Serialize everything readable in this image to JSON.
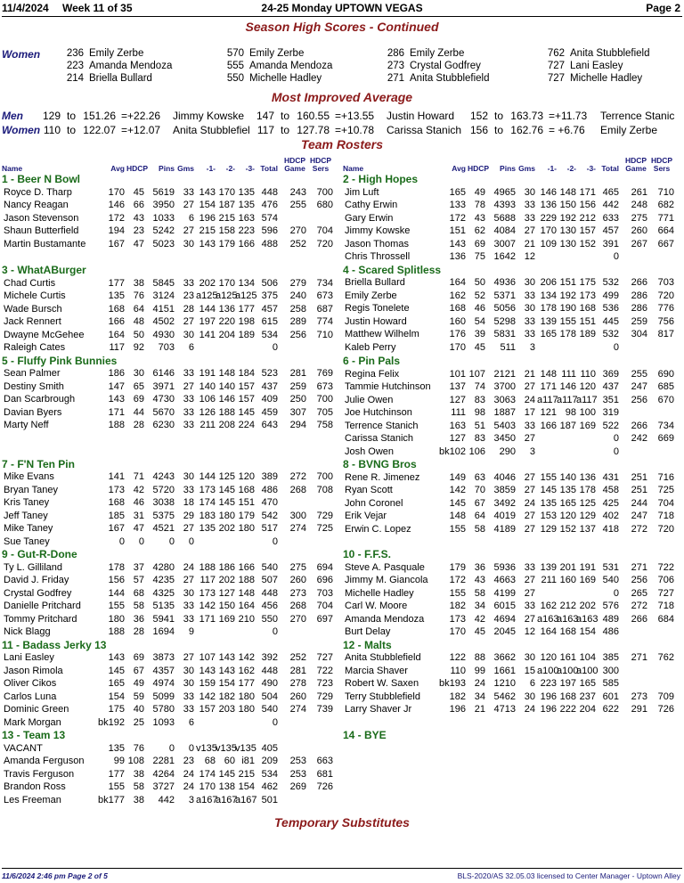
{
  "header": {
    "date": "11/4/2024",
    "week": "Week 11 of 35",
    "title": "24-25 Monday UPTOWN VEGAS",
    "page": "Page 2"
  },
  "sections": {
    "season_high": "Season High Scores - Continued",
    "most_improved": "Most Improved Average",
    "rosters": "Team Rosters",
    "temp_subs": "Temporary Substitutes"
  },
  "season_high": {
    "label": "Women",
    "blocks": [
      [
        [
          "236",
          "Emily Zerbe"
        ],
        [
          "223",
          "Amanda Mendoza"
        ],
        [
          "214",
          "Briella Bullard"
        ]
      ],
      [
        [
          "570",
          "Emily Zerbe"
        ],
        [
          "555",
          "Amanda Mendoza"
        ],
        [
          "550",
          "Michelle Hadley"
        ]
      ],
      [
        [
          "286",
          "Emily Zerbe"
        ],
        [
          "273",
          "Crystal Godfrey"
        ],
        [
          "271",
          "Anita Stubblefield"
        ]
      ],
      [
        [
          "762",
          "Anita Stubblefield"
        ],
        [
          "727",
          "Lani Easley"
        ],
        [
          "727",
          "Michelle Hadley"
        ]
      ]
    ]
  },
  "most_improved": [
    {
      "label": "Men",
      "entries": [
        [
          "129",
          "to",
          "151.26",
          "=+22.26",
          "Jimmy Kowske"
        ],
        [
          "147",
          "to",
          "160.55",
          "=+13.55",
          "Justin Howard"
        ],
        [
          "152",
          "to",
          "163.73",
          "=+11.73",
          "Terrence Stanic"
        ]
      ]
    },
    {
      "label": "Women",
      "entries": [
        [
          "110",
          "to",
          "122.07",
          "=+12.07",
          "Anita Stubblefiel"
        ],
        [
          "117",
          "to",
          "127.78",
          "=+10.78",
          "Carissa Stanich"
        ],
        [
          "156",
          "to",
          "162.76",
          "= +6.76",
          "Emily Zerbe"
        ]
      ]
    }
  ],
  "col_headers": {
    "name": "Name",
    "avg": "Avg",
    "hdcp": "HDCP",
    "pins": "Pins",
    "gms": "Gms",
    "g1": "-1-",
    "g2": "-2-",
    "g3": "-3-",
    "total": "Total",
    "hdcp_game": "HDCP Game",
    "hdcp_sers": "HDCP Sers"
  },
  "left_teams": [
    {
      "name": "1 - Beer N Bowl",
      "players": [
        [
          "Royce D. Tharp",
          "170",
          "45",
          "5619",
          "33",
          "143",
          "170",
          "135",
          "448",
          "243",
          "700"
        ],
        [
          "Nancy Reagan",
          "146",
          "66",
          "3950",
          "27",
          "154",
          "187",
          "135",
          "476",
          "255",
          "680"
        ],
        [
          "Jason Stevenson",
          "172",
          "43",
          "1033",
          "6",
          "196",
          "215",
          "163",
          "574",
          "",
          ""
        ],
        [
          "Shaun Butterfield",
          "194",
          "23",
          "5242",
          "27",
          "215",
          "158",
          "223",
          "596",
          "270",
          "704"
        ],
        [
          "Martin Bustamante",
          "167",
          "47",
          "5023",
          "30",
          "143",
          "179",
          "166",
          "488",
          "252",
          "720"
        ]
      ]
    },
    {
      "name": "3 - WhatABurger",
      "players": [
        [
          "Chad Curtis",
          "177",
          "38",
          "5845",
          "33",
          "202",
          "170",
          "134",
          "506",
          "279",
          "734"
        ],
        [
          "Michele Curtis",
          "135",
          "76",
          "3124",
          "23",
          "a125",
          "a125",
          "a125",
          "375",
          "240",
          "673"
        ],
        [
          "Wade Bursch",
          "168",
          "64",
          "4151",
          "28",
          "144",
          "136",
          "177",
          "457",
          "258",
          "687"
        ],
        [
          "Jack Rennert",
          "166",
          "48",
          "4502",
          "27",
          "197",
          "220",
          "198",
          "615",
          "289",
          "774"
        ],
        [
          "Dwayne McGehee",
          "164",
          "50",
          "4930",
          "30",
          "141",
          "204",
          "189",
          "534",
          "256",
          "710"
        ],
        [
          "Raleigh Cates",
          "117",
          "92",
          "703",
          "6",
          "",
          "",
          "",
          "0",
          "",
          ""
        ]
      ]
    },
    {
      "name": "5 - Fluffy Pink Bunnies",
      "players": [
        [
          "Sean Palmer",
          "186",
          "30",
          "6146",
          "33",
          "191",
          "148",
          "184",
          "523",
          "281",
          "769"
        ],
        [
          "Destiny Smith",
          "147",
          "65",
          "3971",
          "27",
          "140",
          "140",
          "157",
          "437",
          "259",
          "673"
        ],
        [
          "Dan Scarbrough",
          "143",
          "69",
          "4730",
          "33",
          "106",
          "146",
          "157",
          "409",
          "250",
          "700"
        ],
        [
          "Davian Byers",
          "171",
          "44",
          "5670",
          "33",
          "126",
          "188",
          "145",
          "459",
          "307",
          "705"
        ],
        [
          "Marty Neff",
          "188",
          "28",
          "6230",
          "33",
          "211",
          "208",
          "224",
          "643",
          "294",
          "758"
        ]
      ]
    },
    {
      "name": "7 - F'N Ten Pin",
      "players": [
        [
          "Mike Evans",
          "141",
          "71",
          "4243",
          "30",
          "144",
          "125",
          "120",
          "389",
          "272",
          "700"
        ],
        [
          "Bryan Taney",
          "173",
          "42",
          "5720",
          "33",
          "173",
          "145",
          "168",
          "486",
          "268",
          "708"
        ],
        [
          "Kris Taney",
          "168",
          "46",
          "3038",
          "18",
          "174",
          "145",
          "151",
          "470",
          "",
          ""
        ],
        [
          "Jeff Taney",
          "185",
          "31",
          "5375",
          "29",
          "183",
          "180",
          "179",
          "542",
          "300",
          "729"
        ],
        [
          "Mike Taney",
          "167",
          "47",
          "4521",
          "27",
          "135",
          "202",
          "180",
          "517",
          "274",
          "725"
        ],
        [
          "Sue Taney",
          "0",
          "0",
          "0",
          "0",
          "",
          "",
          "",
          "0",
          "",
          ""
        ]
      ]
    },
    {
      "name": "9 - Gut-R-Done",
      "players": [
        [
          "Ty L. Gilliland",
          "178",
          "37",
          "4280",
          "24",
          "188",
          "186",
          "166",
          "540",
          "275",
          "694"
        ],
        [
          "David J. Friday",
          "156",
          "57",
          "4235",
          "27",
          "117",
          "202",
          "188",
          "507",
          "260",
          "696"
        ],
        [
          "Crystal Godfrey",
          "144",
          "68",
          "4325",
          "30",
          "173",
          "127",
          "148",
          "448",
          "273",
          "703"
        ],
        [
          "Danielle Pritchard",
          "155",
          "58",
          "5135",
          "33",
          "142",
          "150",
          "164",
          "456",
          "268",
          "704"
        ],
        [
          "Tommy Pritchard",
          "180",
          "36",
          "5941",
          "33",
          "171",
          "169",
          "210",
          "550",
          "270",
          "697"
        ],
        [
          "Nick Blagg",
          "188",
          "28",
          "1694",
          "9",
          "",
          "",
          "",
          "0",
          "",
          ""
        ]
      ]
    },
    {
      "name": "11 - Badass Jerky 13",
      "players": [
        [
          "Lani Easley",
          "143",
          "69",
          "3873",
          "27",
          "107",
          "143",
          "142",
          "392",
          "252",
          "727"
        ],
        [
          "Jason Rimola",
          "145",
          "67",
          "4357",
          "30",
          "143",
          "143",
          "162",
          "448",
          "281",
          "722"
        ],
        [
          "Oliver Cikos",
          "165",
          "49",
          "4974",
          "30",
          "159",
          "154",
          "177",
          "490",
          "278",
          "723"
        ],
        [
          "Carlos Luna",
          "154",
          "59",
          "5099",
          "33",
          "142",
          "182",
          "180",
          "504",
          "260",
          "729"
        ],
        [
          "Dominic Green",
          "175",
          "40",
          "5780",
          "33",
          "157",
          "203",
          "180",
          "540",
          "274",
          "739"
        ],
        [
          "Mark Morgan",
          "bk192",
          "25",
          "1093",
          "6",
          "",
          "",
          "",
          "0",
          "",
          ""
        ]
      ]
    },
    {
      "name": "13 - Team 13",
      "players": [
        [
          "VACANT",
          "135",
          "76",
          "0",
          "0",
          "v135",
          "v135",
          "v135",
          "405",
          "",
          ""
        ],
        [
          "Amanda Ferguson",
          "99",
          "108",
          "2281",
          "23",
          "68",
          "60",
          "i81",
          "209",
          "253",
          "663"
        ],
        [
          "Travis Ferguson",
          "177",
          "38",
          "4264",
          "24",
          "174",
          "145",
          "215",
          "534",
          "253",
          "681"
        ],
        [
          "Brandon Ross",
          "155",
          "58",
          "3727",
          "24",
          "170",
          "138",
          "154",
          "462",
          "269",
          "726"
        ],
        [
          "Les Freeman",
          "bk177",
          "38",
          "442",
          "3",
          "a167",
          "a167",
          "a167",
          "501",
          "",
          ""
        ]
      ]
    }
  ],
  "right_teams": [
    {
      "name": "2 - High Hopes",
      "players": [
        [
          "Jim Luft",
          "165",
          "49",
          "4965",
          "30",
          "146",
          "148",
          "171",
          "465",
          "261",
          "710"
        ],
        [
          "Cathy Erwin",
          "133",
          "78",
          "4393",
          "33",
          "136",
          "150",
          "156",
          "442",
          "248",
          "682"
        ],
        [
          "Gary Erwin",
          "172",
          "43",
          "5688",
          "33",
          "229",
          "192",
          "212",
          "633",
          "275",
          "771"
        ],
        [
          "Jimmy Kowske",
          "151",
          "62",
          "4084",
          "27",
          "170",
          "130",
          "157",
          "457",
          "260",
          "664"
        ],
        [
          "Jason Thomas",
          "143",
          "69",
          "3007",
          "21",
          "109",
          "130",
          "152",
          "391",
          "267",
          "667"
        ],
        [
          "Chris Throssell",
          "136",
          "75",
          "1642",
          "12",
          "",
          "",
          "",
          "0",
          "",
          ""
        ]
      ]
    },
    {
      "name": "4 - Scared Splitless",
      "players": [
        [
          "Briella Bullard",
          "164",
          "50",
          "4936",
          "30",
          "206",
          "151",
          "175",
          "532",
          "266",
          "703"
        ],
        [
          "Emily Zerbe",
          "162",
          "52",
          "5371",
          "33",
          "134",
          "192",
          "173",
          "499",
          "286",
          "720"
        ],
        [
          "Regis Tonelete",
          "168",
          "46",
          "5056",
          "30",
          "178",
          "190",
          "168",
          "536",
          "286",
          "776"
        ],
        [
          "Justin Howard",
          "160",
          "54",
          "5298",
          "33",
          "139",
          "155",
          "151",
          "445",
          "259",
          "756"
        ],
        [
          "Matthew Wilhelm",
          "176",
          "39",
          "5831",
          "33",
          "165",
          "178",
          "189",
          "532",
          "304",
          "817"
        ],
        [
          "Kaleb Perry",
          "170",
          "45",
          "511",
          "3",
          "",
          "",
          "",
          "0",
          "",
          ""
        ]
      ]
    },
    {
      "name": "6 - Pin Pals",
      "players": [
        [
          "Regina Felix",
          "101",
          "107",
          "2121",
          "21",
          "148",
          "111",
          "110",
          "369",
          "255",
          "690"
        ],
        [
          "Tammie Hutchinson",
          "137",
          "74",
          "3700",
          "27",
          "171",
          "146",
          "120",
          "437",
          "247",
          "685"
        ],
        [
          "Julie Owen",
          "127",
          "83",
          "3063",
          "24",
          "a117",
          "a117",
          "a117",
          "351",
          "256",
          "670"
        ],
        [
          "Joe Hutchinson",
          "111",
          "98",
          "1887",
          "17",
          "121",
          "98",
          "100",
          "319",
          "",
          ""
        ],
        [
          "Terrence Stanich",
          "163",
          "51",
          "5403",
          "33",
          "166",
          "187",
          "169",
          "522",
          "266",
          "734"
        ],
        [
          "Carissa Stanich",
          "127",
          "83",
          "3450",
          "27",
          "",
          "",
          "",
          "0",
          "242",
          "669"
        ],
        [
          "Josh Owen",
          "bk102",
          "106",
          "290",
          "3",
          "",
          "",
          "",
          "0",
          "",
          ""
        ]
      ]
    },
    {
      "name": "8 - BVNG Bros",
      "players": [
        [
          "Rene R. Jimenez",
          "149",
          "63",
          "4046",
          "27",
          "155",
          "140",
          "136",
          "431",
          "251",
          "716"
        ],
        [
          "Ryan Scott",
          "142",
          "70",
          "3859",
          "27",
          "145",
          "135",
          "178",
          "458",
          "251",
          "725"
        ],
        [
          "John Coronel",
          "145",
          "67",
          "3492",
          "24",
          "135",
          "165",
          "125",
          "425",
          "244",
          "704"
        ],
        [
          "Erik Vejar",
          "148",
          "64",
          "4019",
          "27",
          "153",
          "120",
          "129",
          "402",
          "247",
          "718"
        ],
        [
          "Erwin C. Lopez",
          "155",
          "58",
          "4189",
          "27",
          "129",
          "152",
          "137",
          "418",
          "272",
          "720"
        ]
      ]
    },
    {
      "name": "10 - F.F.S.",
      "players": [
        [
          "Steve A. Pasquale",
          "179",
          "36",
          "5936",
          "33",
          "139",
          "201",
          "191",
          "531",
          "271",
          "722"
        ],
        [
          "Jimmy M. Giancola",
          "172",
          "43",
          "4663",
          "27",
          "211",
          "160",
          "169",
          "540",
          "256",
          "706"
        ],
        [
          "Michelle Hadley",
          "155",
          "58",
          "4199",
          "27",
          "",
          "",
          "",
          "0",
          "265",
          "727"
        ],
        [
          "Carl W. Moore",
          "182",
          "34",
          "6015",
          "33",
          "162",
          "212",
          "202",
          "576",
          "272",
          "718"
        ],
        [
          "Amanda Mendoza",
          "173",
          "42",
          "4694",
          "27",
          "a163",
          "a163",
          "a163",
          "489",
          "266",
          "684"
        ],
        [
          "Burt Delay",
          "170",
          "45",
          "2045",
          "12",
          "164",
          "168",
          "154",
          "486",
          "",
          ""
        ]
      ]
    },
    {
      "name": "12 - Malts",
      "players": [
        [
          "Anita Stubblefield",
          "122",
          "88",
          "3662",
          "30",
          "120",
          "161",
          "104",
          "385",
          "271",
          "762"
        ],
        [
          "Marcia Shaver",
          "110",
          "99",
          "1661",
          "15",
          "a100",
          "a100",
          "a100",
          "300",
          "",
          ""
        ],
        [
          "Robert W. Saxen",
          "bk193",
          "24",
          "1210",
          "6",
          "223",
          "197",
          "165",
          "585",
          "",
          ""
        ],
        [
          "Terry Stubblefield",
          "182",
          "34",
          "5462",
          "30",
          "196",
          "168",
          "237",
          "601",
          "273",
          "709"
        ],
        [
          "Larry Shaver Jr",
          "196",
          "21",
          "4713",
          "24",
          "196",
          "222",
          "204",
          "622",
          "291",
          "726"
        ]
      ]
    },
    {
      "name": "14 - BYE",
      "players": []
    }
  ],
  "footer": {
    "left": "11/6/2024  2:46 pm  Page 2 of 5",
    "right": "BLS-2020/AS 32.05.03 licensed to Center Manager - Uptown Alley"
  }
}
